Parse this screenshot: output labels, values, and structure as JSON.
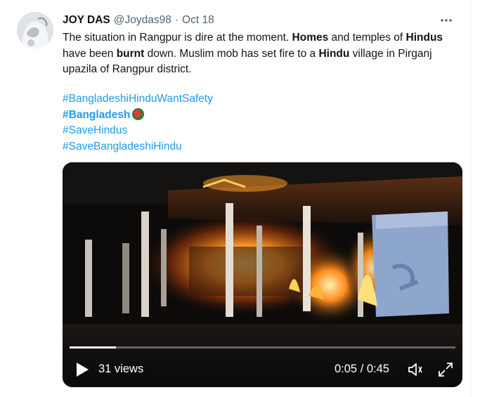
{
  "tweet": {
    "author_name": "JOY DAS",
    "handle": "@Joydas98",
    "separator": "·",
    "date": "Oct 18",
    "more_icon": "more-horizontal-icon",
    "text": [
      {
        "t": "The situation in Rangpur is dire at the moment. ",
        "b": false
      },
      {
        "t": "Homes",
        "b": true
      },
      {
        "t": " and temples of ",
        "b": false
      },
      {
        "t": "Hindus",
        "b": true
      },
      {
        "t": " have been ",
        "b": false
      },
      {
        "t": "burnt",
        "b": true
      },
      {
        "t": " down. Muslim mob has set fire to a ",
        "b": false
      },
      {
        "t": "Hindu",
        "b": true
      },
      {
        "t": " village in Pirganj upazila of Rangpur district.",
        "b": false
      }
    ],
    "hashtags": [
      {
        "label": "#BangladeshiHinduWantSafety",
        "bold": false,
        "emoji": ""
      },
      {
        "label": "#Bangladesh",
        "bold": true,
        "emoji": "bangladesh-flag"
      },
      {
        "label": "#SaveHindus",
        "bold": false,
        "emoji": ""
      },
      {
        "label": "#SaveBangladeshiHindu",
        "bold": false,
        "emoji": ""
      }
    ]
  },
  "video": {
    "views": "31 views",
    "time": "0:05 / 0:45",
    "progress": 0.12,
    "colors": {
      "fire": "#ff8a1c",
      "glow": "#ffd15a",
      "dark": "#0c0b0a",
      "wall": "#9db4d8"
    },
    "icons": {
      "play": "play-icon",
      "volume": "volume-icon",
      "fullscreen": "fullscreen-icon"
    }
  }
}
